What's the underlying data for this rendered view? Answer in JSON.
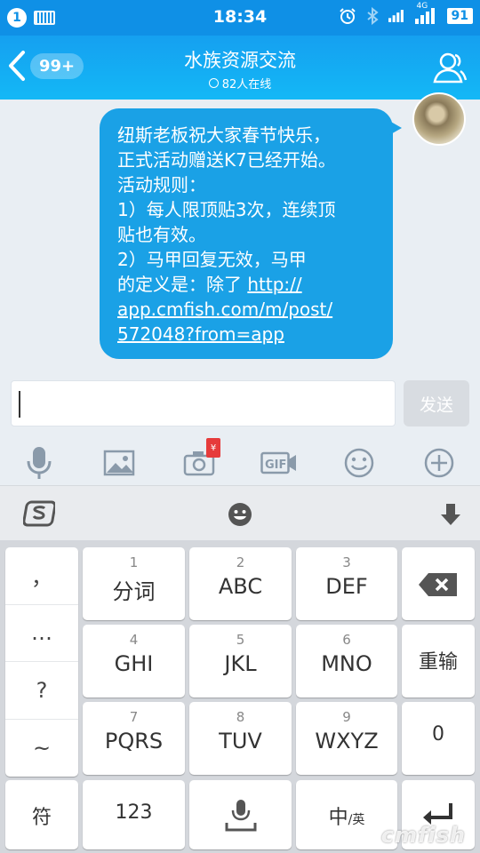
{
  "status_bar": {
    "notification_count": "1",
    "time": "18:34",
    "network_label": "4G",
    "battery": "91"
  },
  "header": {
    "unread_count": "99+",
    "title": "水族资源交流",
    "online_text": "82人在线"
  },
  "message": {
    "lines": [
      "纽斯老板祝大家春节快乐，",
      "正式活动赠送K7已经开始。",
      "活动规则：",
      "1）每人限顶贴3次，连续顶",
      "贴也有效。",
      "2）马甲回复无效，马甲",
      "的定义是：除了 "
    ],
    "link_inline": "http://",
    "link_lines": [
      "app.cmfish.com/m/post/",
      "572048?from=app"
    ]
  },
  "composer": {
    "send_label": "发送",
    "gift_badge": "¥"
  },
  "toolbar_icons": [
    "microphone-icon",
    "image-icon",
    "camera-icon",
    "gif-icon",
    "emoji-icon",
    "plus-icon"
  ],
  "keyboard": {
    "side_keys": [
      "，",
      "…",
      "?",
      "~"
    ],
    "keys": [
      {
        "num": "1",
        "label": "分词"
      },
      {
        "num": "2",
        "label": "ABC"
      },
      {
        "num": "3",
        "label": "DEF"
      },
      {
        "num": "4",
        "label": "GHI"
      },
      {
        "num": "5",
        "label": "JKL"
      },
      {
        "num": "6",
        "label": "MNO"
      },
      {
        "num": "7",
        "label": "PQRS"
      },
      {
        "num": "8",
        "label": "TUV"
      },
      {
        "num": "9",
        "label": "WXYZ"
      }
    ],
    "reenter_label": "重输",
    "zero_label": "0",
    "symbol_label": "符",
    "numbers_label": "123",
    "lang_main": "中",
    "lang_sub": "/英"
  },
  "watermark": "cmfish"
}
